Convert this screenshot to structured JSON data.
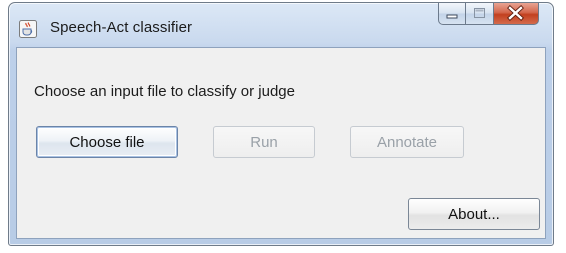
{
  "window": {
    "title": "Speech-Act classifier",
    "app_icon": "java-cup-icon",
    "controls": {
      "minimize_icon": "minimize-icon",
      "maximize_icon": "maximize-icon",
      "close_icon": "close-icon"
    }
  },
  "main": {
    "prompt": "Choose an input file to classify or judge",
    "buttons": {
      "choose_file": {
        "label": "Choose file",
        "enabled": true
      },
      "run": {
        "label": "Run",
        "enabled": false
      },
      "annotate": {
        "label": "Annotate",
        "enabled": false
      },
      "about": {
        "label": "About...",
        "enabled": true
      }
    }
  },
  "colors": {
    "title_bar": "#c9d9ee",
    "close_button": "#c9462a",
    "dialog_background": "#f0f0f0",
    "disabled_text": "#9aa1a8"
  }
}
